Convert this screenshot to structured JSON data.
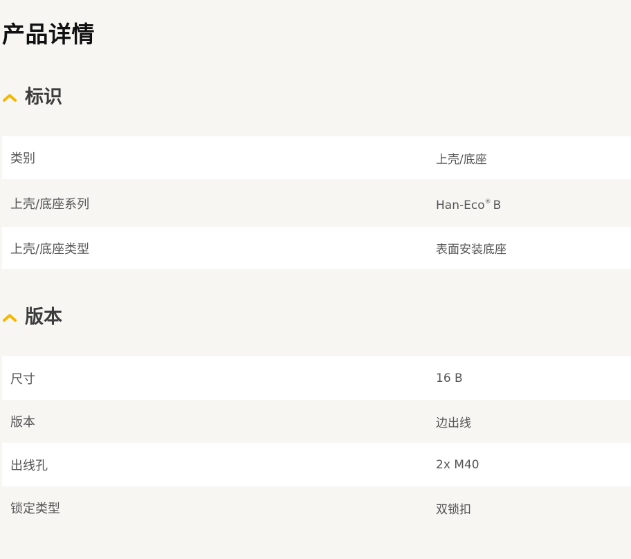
{
  "page": {
    "title": "产品详情"
  },
  "sections": [
    {
      "title": "标识",
      "icon": "chevron-up-icon",
      "rows": [
        {
          "label": "类别",
          "value": "上壳/底座"
        },
        {
          "label": "上壳/底座系列",
          "value_main": "Han-Eco",
          "value_mark": "®",
          "value_suffix": "B"
        },
        {
          "label": "上壳/底座类型",
          "value": "表面安装底座"
        }
      ]
    },
    {
      "title": "版本",
      "icon": "chevron-up-icon",
      "rows": [
        {
          "label": "尺寸",
          "value": "16 B"
        },
        {
          "label": "版本",
          "value": "边出线"
        },
        {
          "label": "出线孔",
          "value": "2x M40"
        },
        {
          "label": "锁定类型",
          "value": "双锁扣"
        }
      ]
    }
  ],
  "colors": {
    "accent": "#f5b800",
    "page_background": "#f7f6f3",
    "row_white": "#ffffff",
    "heading": "#111111",
    "text": "#555555"
  }
}
